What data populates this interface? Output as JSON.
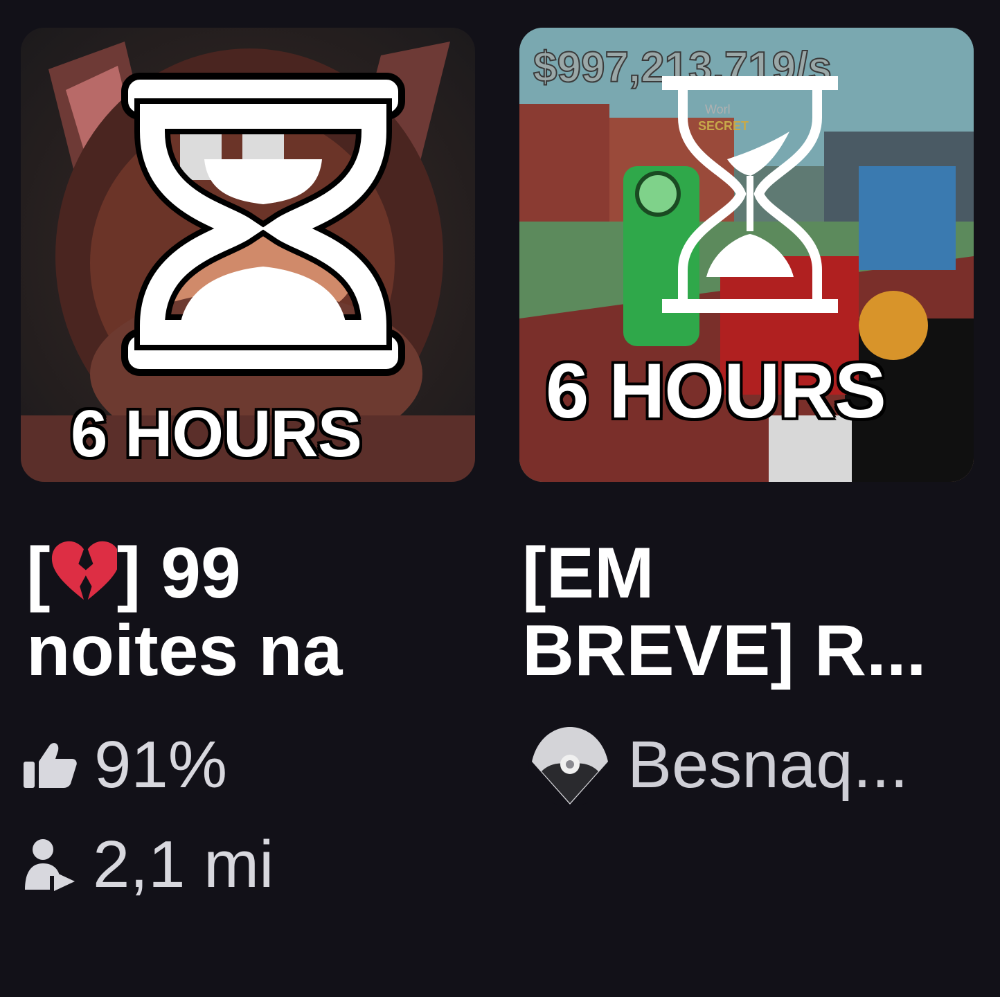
{
  "games": [
    {
      "badge_text": "6 HOURS",
      "title_prefix_open": "[",
      "title_prefix_close": "] 99",
      "title_line2": "noites na",
      "title_emoji": "broken-heart-icon",
      "rating": "91%",
      "players": "2,1 mi"
    },
    {
      "badge_text": "6 HOURS",
      "overlay_money": "$997,213,719/s",
      "overlay_small_1": "Worl",
      "overlay_small_2": "SECRET",
      "title_line1": "[EM",
      "title_line2": "BREVE] R...",
      "creator": "Besnaq..."
    }
  ],
  "colors": {
    "background": "#121118",
    "heart": "#dd2e44",
    "meta_text": "#d8d8de"
  }
}
